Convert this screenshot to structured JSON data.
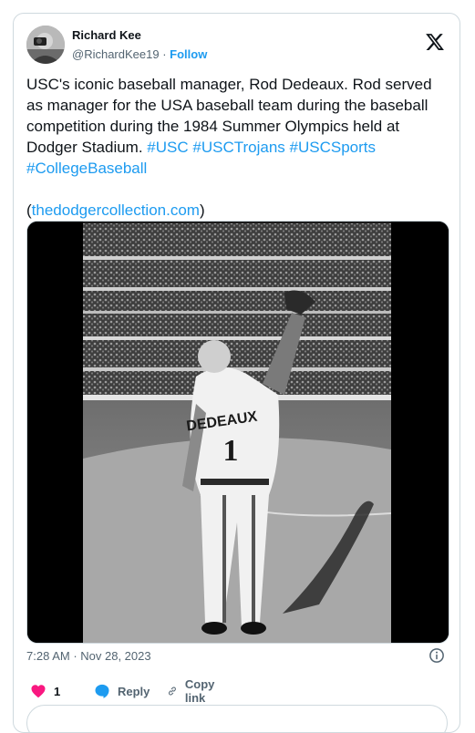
{
  "author": {
    "name": "Richard Kee",
    "handle": "@RichardKee19",
    "separator": " · ",
    "follow_label": "Follow"
  },
  "tweet": {
    "text_plain": "USC's iconic baseball manager, Rod Dedeaux. Rod served as manager for the USA baseball team during the baseball competition during the 1984 Summer Olympics held at Dodger Stadium. ",
    "hashtags": [
      "#USC",
      "#USCTrojans",
      "#USCSports",
      "#CollegeBaseball"
    ],
    "link_open": "(",
    "link": "thedodgercollection.com",
    "link_close": ")"
  },
  "media": {
    "jersey_name": "DEDEAUX",
    "jersey_number": "1"
  },
  "meta": {
    "time": "7:28 AM",
    "separator": " · ",
    "date": "Nov 28, 2023"
  },
  "actions": {
    "like_count": "1",
    "reply_label": "Reply",
    "copy_label": "Copy link"
  },
  "colors": {
    "link": "#1d9bf0",
    "like": "#f91880",
    "text": "#0f1419",
    "muted": "#536471"
  },
  "icons": [
    "x-logo-icon",
    "info-icon",
    "heart-icon",
    "reply-icon",
    "link-icon"
  ]
}
